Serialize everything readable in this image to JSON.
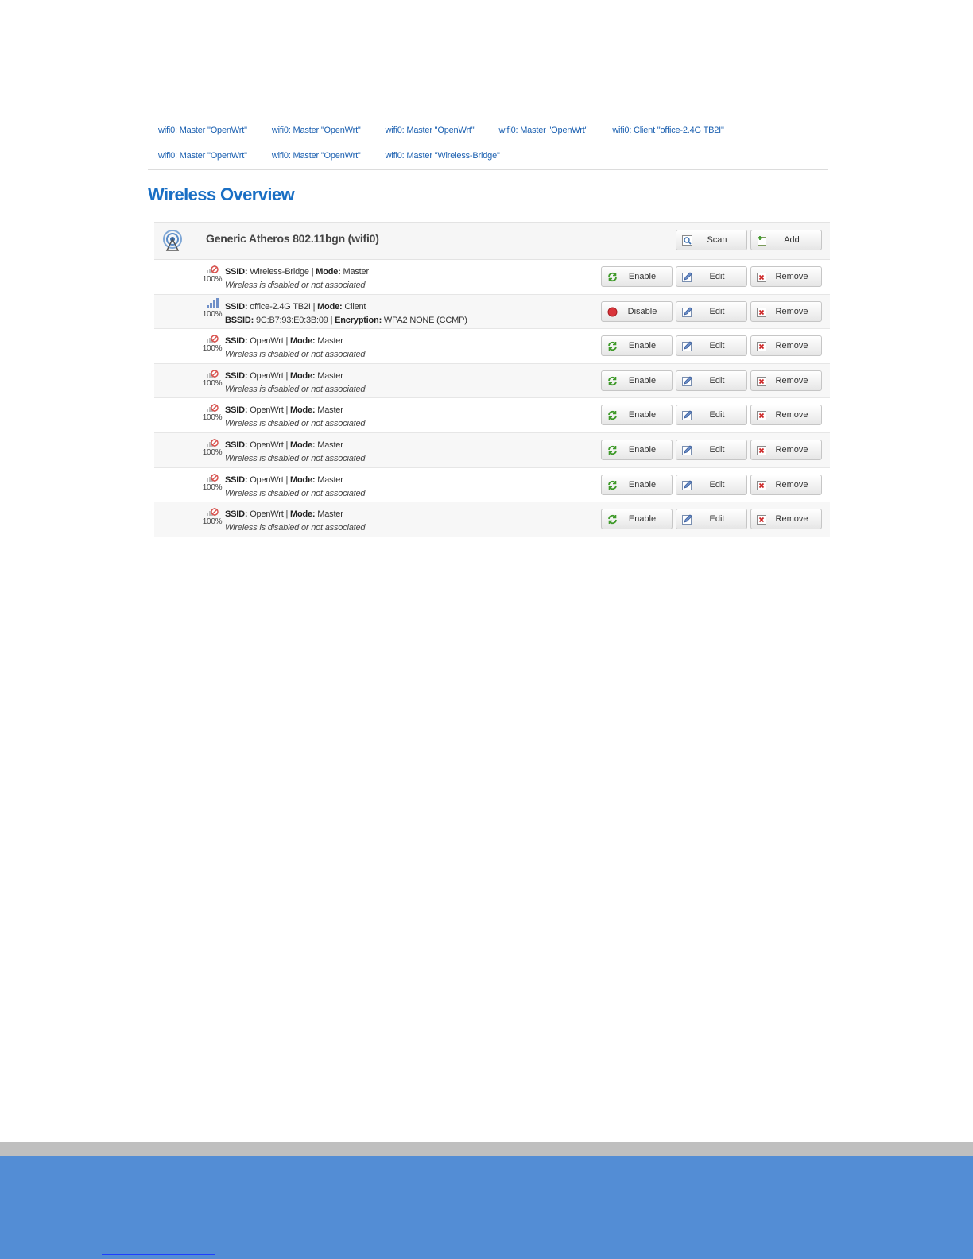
{
  "tabs": [
    [
      "wifi0: Master \"OpenWrt\"",
      "wifi0: Master \"OpenWrt\"",
      "wifi0: Master \"OpenWrt\"",
      "wifi0: Master \"OpenWrt\"",
      "wifi0: Client \"office-2.4G TB2I\""
    ],
    [
      "wifi0: Master \"OpenWrt\"",
      "wifi0: Master \"OpenWrt\"",
      "wifi0: Master \"Wireless-Bridge\""
    ]
  ],
  "page_title": "Wireless Overview",
  "radio": {
    "name": "Generic Atheros 802.11bgn (wifi0)",
    "scan_label": "Scan",
    "add_label": "Add"
  },
  "labels": {
    "ssid": "SSID:",
    "mode": "Mode:",
    "bssid": "BSSID:",
    "encryption": "Encryption:",
    "separator": "|",
    "edit": "Edit",
    "remove": "Remove"
  },
  "networks": [
    {
      "ssid": "Wireless-Bridge",
      "mode": "Master",
      "signal": "100%",
      "status": "Wireless is disabled or not associated",
      "toggle": "Enable"
    },
    {
      "ssid": "office-2.4G TB2I",
      "mode": "Client",
      "signal": "100%",
      "bssid": "9C:B7:93:E0:3B:09",
      "encryption": "WPA2 NONE (CCMP)",
      "toggle": "Disable"
    },
    {
      "ssid": "OpenWrt",
      "mode": "Master",
      "signal": "100%",
      "status": "Wireless is disabled or not associated",
      "toggle": "Enable"
    },
    {
      "ssid": "OpenWrt",
      "mode": "Master",
      "signal": "100%",
      "status": "Wireless is disabled or not associated",
      "toggle": "Enable"
    },
    {
      "ssid": "OpenWrt",
      "mode": "Master",
      "signal": "100%",
      "status": "Wireless is disabled or not associated",
      "toggle": "Enable"
    },
    {
      "ssid": "OpenWrt",
      "mode": "Master",
      "signal": "100%",
      "status": "Wireless is disabled or not associated",
      "toggle": "Enable"
    },
    {
      "ssid": "OpenWrt",
      "mode": "Master",
      "signal": "100%",
      "status": "Wireless is disabled or not associated",
      "toggle": "Enable"
    },
    {
      "ssid": "OpenWrt",
      "mode": "Master",
      "signal": "100%",
      "status": "Wireless is disabled or not associated",
      "toggle": "Enable"
    }
  ],
  "colors": {
    "link": "#1a5fb0",
    "title": "#1a6fc4",
    "footer_gray": "#bfbfbf",
    "footer_blue": "#538dd5"
  }
}
